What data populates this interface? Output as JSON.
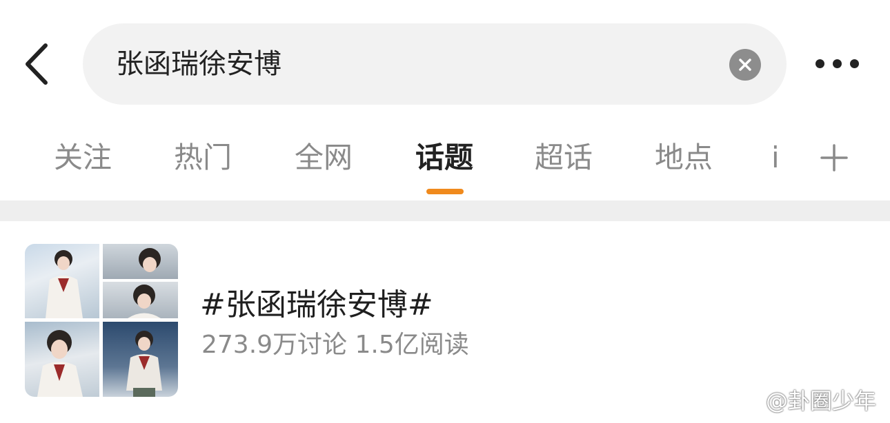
{
  "search": {
    "query": "张函瑞徐安博"
  },
  "tabs": [
    {
      "label": "关注",
      "active": false
    },
    {
      "label": "热门",
      "active": false
    },
    {
      "label": "全网",
      "active": false
    },
    {
      "label": "话题",
      "active": true
    },
    {
      "label": "超话",
      "active": false
    },
    {
      "label": "地点",
      "active": false
    },
    {
      "label": "i",
      "active": false
    }
  ],
  "result": {
    "title": "#张函瑞徐安博#",
    "stats": "273.9万讨论 1.5亿阅读"
  },
  "watermark": {
    "text": "@卦圈少年"
  },
  "icons": {
    "back": "back-arrow-icon",
    "clear": "clear-x-icon",
    "more": "more-dots-icon",
    "plus": "plus-icon",
    "weibo": "weibo-logo-icon"
  },
  "colors": {
    "accent": "#f08a1d",
    "tab_inactive": "#8a8a8a",
    "tab_active": "#222222",
    "search_bg": "#f2f2f2",
    "band_bg": "#eeeeee"
  }
}
